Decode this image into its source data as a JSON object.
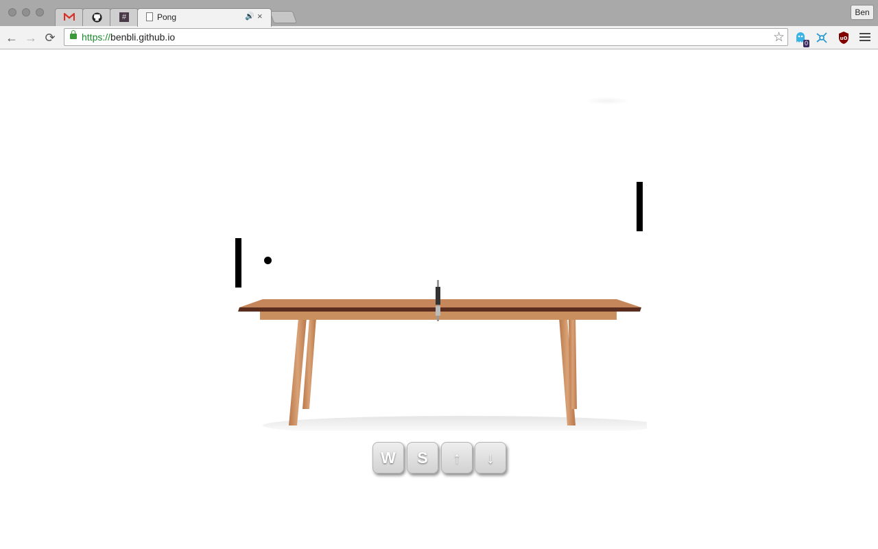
{
  "window": {
    "tabs": [
      {
        "icon": "gmail-icon"
      },
      {
        "icon": "github-icon"
      },
      {
        "icon": "slack-hash-icon",
        "label": "#"
      },
      {
        "icon": "page-icon",
        "label": "Pong",
        "active": true,
        "audio": "🔊",
        "close": "×"
      }
    ],
    "profile_label": "Ben"
  },
  "toolbar": {
    "back": "←",
    "forward": "→",
    "reload": "⟳",
    "url_scheme": "https://",
    "url_host": "benbli.github.io",
    "star": "☆",
    "ghostery_count": "0",
    "extensions": [
      "ghostery-icon",
      "network-icon",
      "ublock-icon"
    ]
  },
  "game": {
    "controls": [
      "W",
      "S",
      "↑",
      "↓"
    ]
  },
  "colors": {
    "secure_green": "#1a8a2a",
    "paddle": "#000000",
    "table_wood": "#c98f5e",
    "table_top": "#5b2d1f"
  }
}
